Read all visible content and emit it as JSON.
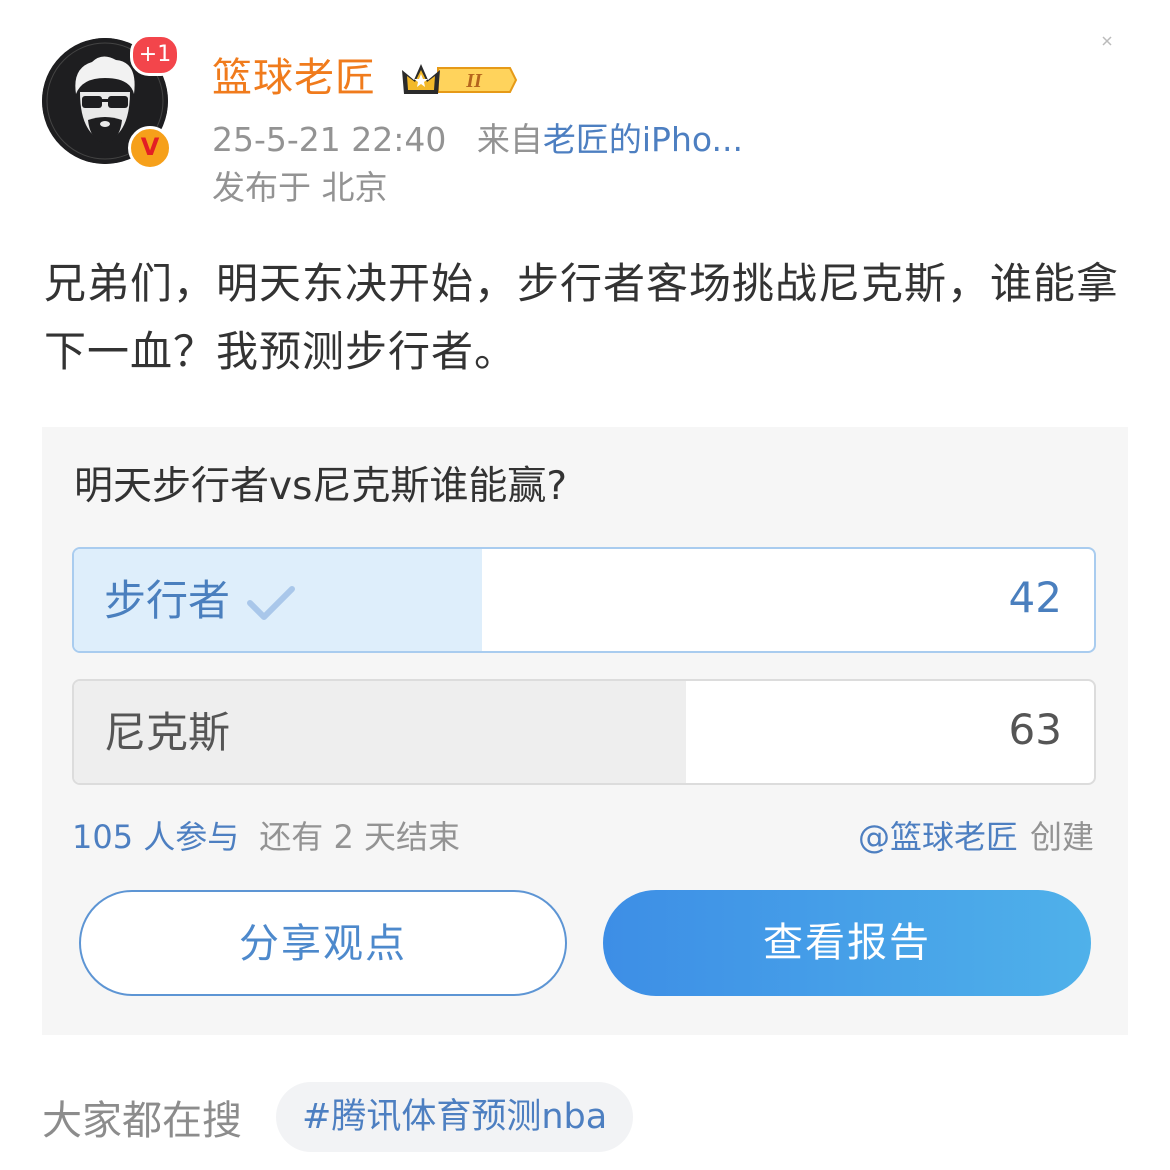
{
  "post": {
    "avatar_badge": "+1",
    "verified_badge": "V",
    "username": "篮球老匠",
    "member_level": "II",
    "time": "25-5-21 22:40",
    "source_prefix": "来自",
    "source": "老匠的iPho...",
    "location": "发布于 北京",
    "text": "兄弟们，明天东决开始，步行者客场挑战尼克斯，谁能拿下一血？我预测步行者。"
  },
  "poll": {
    "question": "明天步行者vs尼克斯谁能赢?",
    "options": [
      {
        "label": "步行者",
        "count": "42",
        "share": 0.4,
        "selected": true,
        "icon": "check-icon"
      },
      {
        "label": "尼克斯",
        "count": "63",
        "share": 0.6,
        "selected": false
      }
    ],
    "participants": "105 人参与",
    "remaining": "还有 2 天结束",
    "creator": "@篮球老匠",
    "created_label": "创建",
    "share_button": "分享观点",
    "report_button": "查看报告",
    "colors": {
      "accent": "#4d7fc1",
      "username": "#f07b1c",
      "selected_fill": "#deeefb",
      "button_gradient": [
        "#3d8ee6",
        "#4fb1ea"
      ]
    }
  },
  "bottom": {
    "search_label": "大家都在搜",
    "hashtag": "#腾讯体育预测nba"
  }
}
